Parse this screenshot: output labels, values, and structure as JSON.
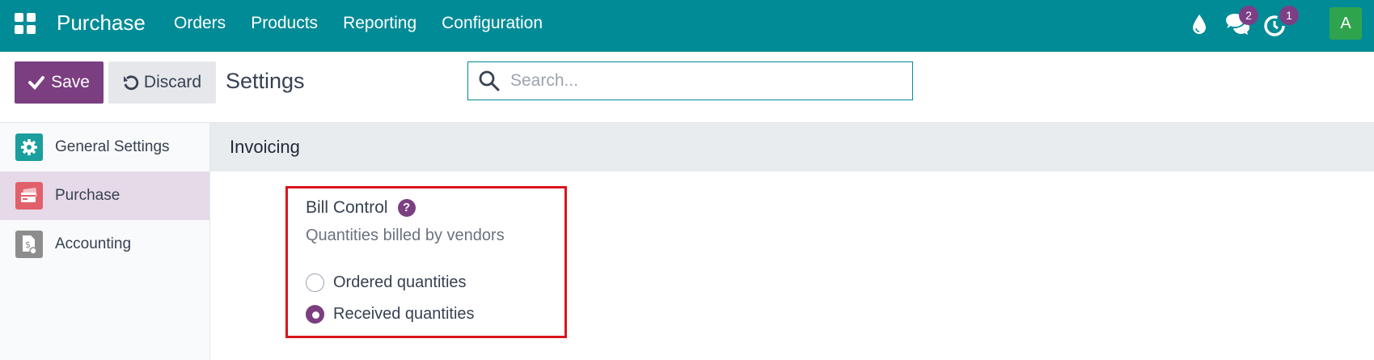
{
  "topbar": {
    "app_name": "Purchase",
    "menu": [
      "Orders",
      "Products",
      "Reporting",
      "Configuration"
    ],
    "chat_badge": "2",
    "activity_badge": "1",
    "avatar_letter": "A",
    "color": "#018b96"
  },
  "control": {
    "save_label": "Save",
    "discard_label": "Discard",
    "title": "Settings",
    "search_placeholder": "Search..."
  },
  "sidebar": {
    "items": [
      {
        "label": "General Settings",
        "icon": "gear-icon",
        "color": "#1a9e9e",
        "active": false
      },
      {
        "label": "Purchase",
        "icon": "purchase-card-icon",
        "color": "#e2606b",
        "active": true
      },
      {
        "label": "Accounting",
        "icon": "accounting-doc-icon",
        "color": "#8d8d8d",
        "active": false
      }
    ]
  },
  "section": {
    "title": "Invoicing",
    "setting": {
      "name": "Bill Control",
      "help": "?",
      "description": "Quantities billed by vendors",
      "options": [
        {
          "label": "Ordered quantities",
          "checked": false
        },
        {
          "label": "Received quantities",
          "checked": true
        }
      ]
    }
  },
  "colors": {
    "accent": "#7b3f81",
    "highlight_border": "#d9151b"
  }
}
